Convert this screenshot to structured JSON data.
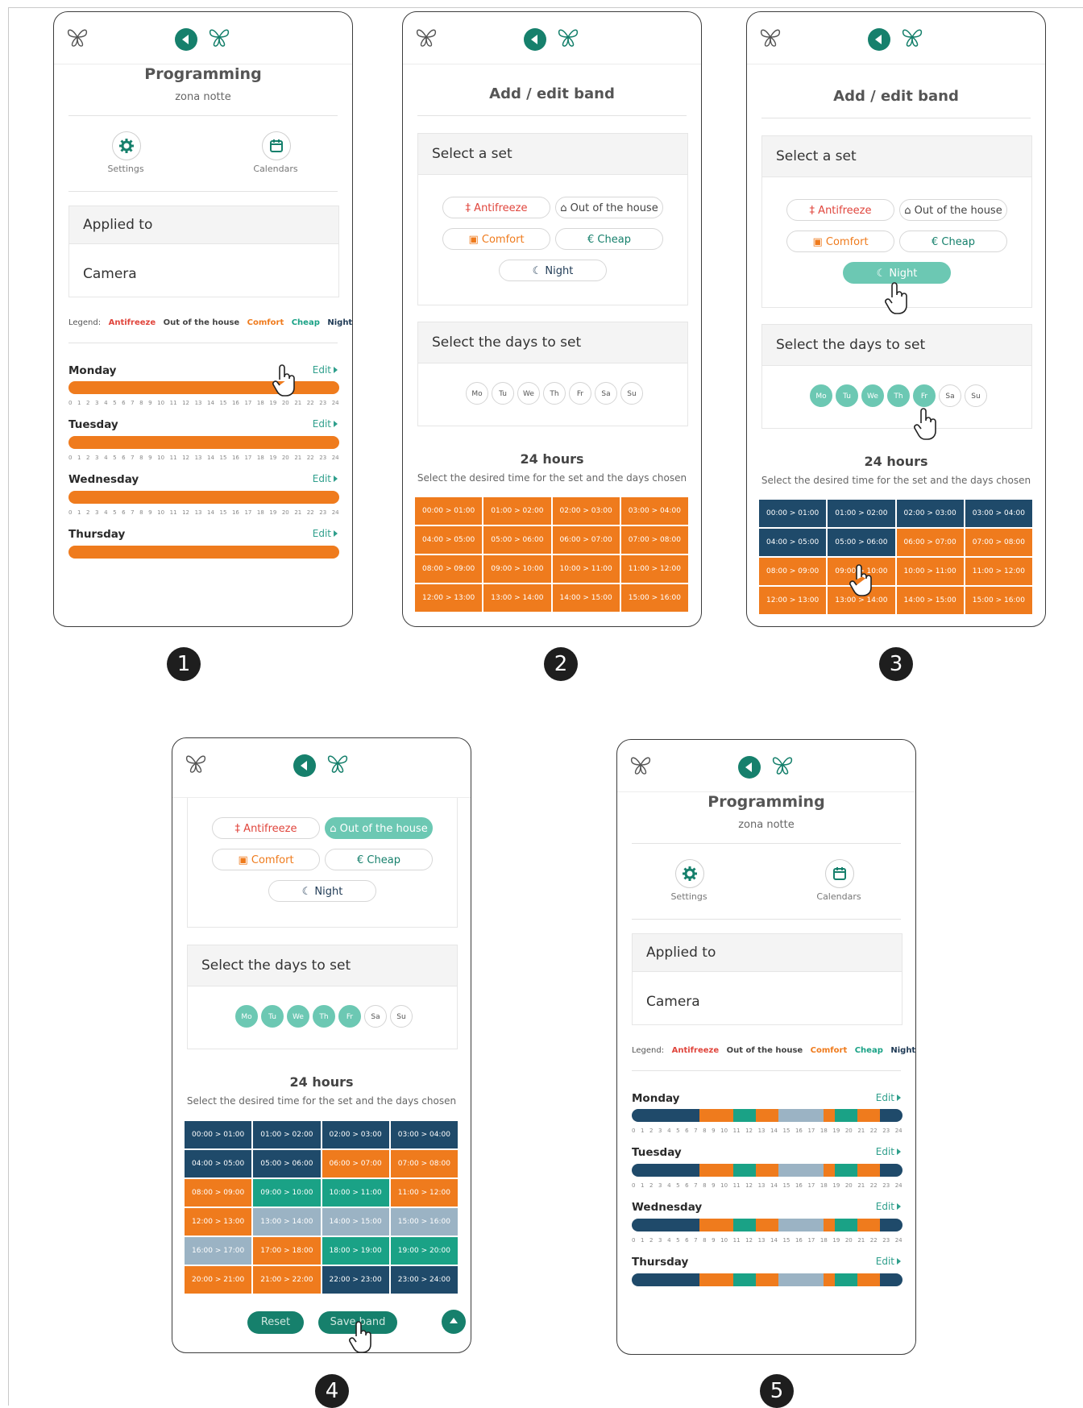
{
  "steps": [
    "1",
    "2",
    "3",
    "4",
    "5"
  ],
  "programming": {
    "title": "Programming",
    "subtitle": "zona notte",
    "settings_label": "Settings",
    "calendars_label": "Calendars",
    "applied_to_header": "Applied to",
    "applied_to_value": "Camera",
    "legend": {
      "label": "Legend:",
      "items": [
        {
          "text": "Antifreeze",
          "color": "#e0453c"
        },
        {
          "text": "Out of the house",
          "color": "#444444"
        },
        {
          "text": "Comfort",
          "color": "#ef7b1d"
        },
        {
          "text": "Cheap",
          "color": "#1aa286"
        },
        {
          "text": "Night",
          "color": "#1f3a55"
        }
      ]
    },
    "days": [
      "Monday",
      "Tuesday",
      "Wednesday",
      "Thursday"
    ],
    "edit_label": "Edit",
    "hour_ticks": [
      "0",
      "1",
      "2",
      "3",
      "4",
      "5",
      "6",
      "7",
      "8",
      "9",
      "10",
      "11",
      "12",
      "13",
      "14",
      "15",
      "16",
      "17",
      "18",
      "19",
      "20",
      "21",
      "22",
      "23",
      "24"
    ]
  },
  "edit_band": {
    "title": "Add / edit band",
    "select_set_header": "Select a set",
    "sets": {
      "antifreeze": "Antifreeze",
      "out_of_house": "Out of the house",
      "comfort": "Comfort",
      "cheap": "Cheap",
      "night": "Night"
    },
    "select_days_header": "Select the days to set",
    "days": [
      "Mo",
      "Tu",
      "We",
      "Th",
      "Fr",
      "Sa",
      "Su"
    ],
    "hours_title": "24 hours",
    "hours_subtitle": "Select the desired time for the set and the days chosen",
    "slots": [
      "00:00 > 01:00",
      "01:00 > 02:00",
      "02:00 > 03:00",
      "03:00 > 04:00",
      "04:00 > 05:00",
      "05:00 > 06:00",
      "06:00 > 07:00",
      "07:00 > 08:00",
      "08:00 > 09:00",
      "09:00 > 10:00",
      "10:00 > 11:00",
      "11:00 > 12:00",
      "12:00 > 13:00",
      "13:00 > 14:00",
      "14:00 > 15:00",
      "15:00 > 16:00",
      "16:00 > 17:00",
      "17:00 > 18:00",
      "18:00 > 19:00",
      "19:00 > 20:00",
      "20:00 > 21:00",
      "21:00 > 22:00",
      "22:00 > 23:00",
      "23:00 > 24:00"
    ],
    "reset_label": "Reset",
    "save_label": "Save band"
  },
  "colors": {
    "comfort": "#ef7b1d",
    "night": "#1f4a6a",
    "cheap": "#1aa286",
    "out_of_house": "#9bb3c4",
    "brand": "#16806c"
  },
  "states": {
    "screen3_selected_days": [
      0,
      1,
      2,
      3,
      4
    ],
    "screen3_slot_sets": [
      "night",
      "night",
      "night",
      "night",
      "night",
      "night",
      "comfort",
      "comfort",
      "comfort",
      "comfort",
      "comfort",
      "comfort",
      "comfort",
      "comfort",
      "comfort",
      "comfort"
    ],
    "screen4_slot_sets": [
      "night",
      "night",
      "night",
      "night",
      "night",
      "night",
      "comfort",
      "comfort",
      "comfort",
      "cheap",
      "cheap",
      "comfort",
      "comfort",
      "out_of_house",
      "out_of_house",
      "out_of_house",
      "out_of_house",
      "comfort",
      "cheap",
      "cheap",
      "comfort",
      "comfort",
      "night",
      "night"
    ],
    "day_schedule_screen5": [
      "night",
      "night",
      "night",
      "night",
      "night",
      "night",
      "comfort",
      "comfort",
      "comfort",
      "cheap",
      "cheap",
      "comfort",
      "comfort",
      "out_of_house",
      "out_of_house",
      "out_of_house",
      "out_of_house",
      "comfort",
      "cheap",
      "cheap",
      "comfort",
      "comfort",
      "night",
      "night"
    ]
  }
}
